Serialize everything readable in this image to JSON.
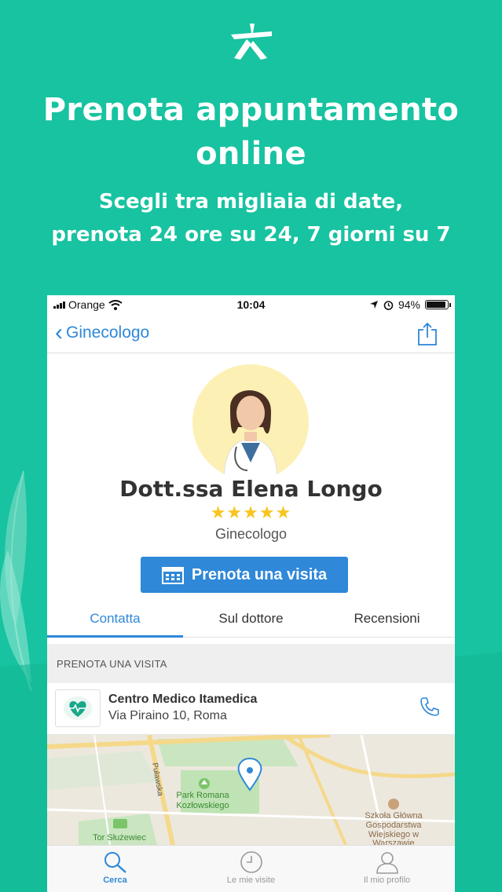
{
  "hero": {
    "title_line1": "Prenota appuntamento",
    "title_line2": "online",
    "subtitle_line1": "Scegli tra migliaia di date,",
    "subtitle_line2": "prenota 24 ore su 24, 7 giorni su 7"
  },
  "status_bar": {
    "carrier": "Orange",
    "time": "10:04",
    "battery": "94%",
    "battery_level": 0.94
  },
  "nav": {
    "back_label": "Ginecologo",
    "share_icon": "share-icon"
  },
  "doctor": {
    "name": "Dott.ssa Elena Longo",
    "rating": 5,
    "rating_max": 5,
    "stars": "★★★★★",
    "specialty": "Ginecologo",
    "book_button": "Prenota una visita"
  },
  "tabs": [
    {
      "label": "Contatta",
      "active": true
    },
    {
      "label": "Sul dottore",
      "active": false
    },
    {
      "label": "Recensioni",
      "active": false
    }
  ],
  "section_header": "PRENOTA UNA VISITA",
  "clinic": {
    "name": "Centro Medico Itamedica",
    "address": "Via Piraino 10, Roma"
  },
  "map": {
    "labels": {
      "street": "Puławska",
      "park": "Park Romana",
      "park2": "Kozłowskiego",
      "school1": "Szkoła Główna",
      "school2": "Gospodarstwa",
      "school3": "Wiejskiego w",
      "school4": "Warszawie",
      "track": "Tor Służewiec"
    }
  },
  "tabbar": [
    {
      "label": "Cerca",
      "active": true
    },
    {
      "label": "Le mie visite",
      "active": false
    },
    {
      "label": "Il mio profilo",
      "active": false
    }
  ],
  "colors": {
    "background": "#17c3a0",
    "accent": "#2f88d8",
    "star": "#f7c51e"
  }
}
